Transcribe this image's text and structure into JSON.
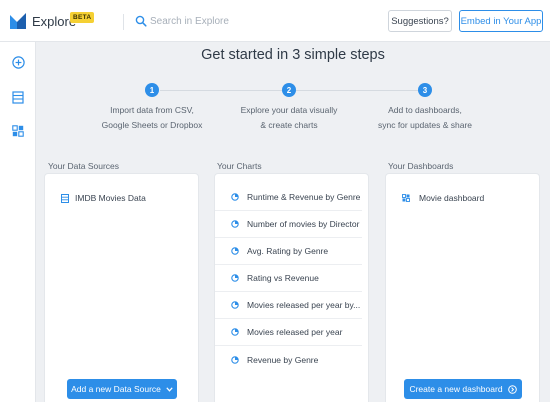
{
  "app": {
    "name": "Explore",
    "badge": "BETA"
  },
  "search": {
    "placeholder": "Search in Explore"
  },
  "header": {
    "suggestions_label": "Suggestions?",
    "embed_label": "Embed in Your App"
  },
  "rail": {
    "icons": [
      "add-circle-icon",
      "datasource-list-icon",
      "dashboard-grid-icon"
    ]
  },
  "main": {
    "headline": "Get started in 3 simple steps",
    "steps": [
      {
        "number": "1",
        "line1": "Import data from CSV,",
        "line2": "Google Sheets or Dropbox"
      },
      {
        "number": "2",
        "line1": "Explore your data visually",
        "line2": "& create charts"
      },
      {
        "number": "3",
        "line1": "Add to dashboards,",
        "line2": "sync for updates & share"
      }
    ]
  },
  "data_sources": {
    "label": "Your Data Sources",
    "items": [
      "IMDB Movies Data"
    ],
    "button_label": "Add a new Data Source"
  },
  "charts": {
    "label": "Your Charts",
    "items": [
      "Runtime & Revenue by Genre",
      "Number of movies by Director",
      "Avg. Rating by Genre",
      "Rating vs Revenue",
      "Movies released per year by...",
      "Movies released per year",
      "Revenue by Genre"
    ]
  },
  "dashboards": {
    "label": "Your Dashboards",
    "items": [
      "Movie dashboard"
    ],
    "button_label": "Create a new dashboard"
  },
  "colors": {
    "accent": "#2d8ee8",
    "badge": "#f5d033",
    "background": "#eef0f3"
  }
}
